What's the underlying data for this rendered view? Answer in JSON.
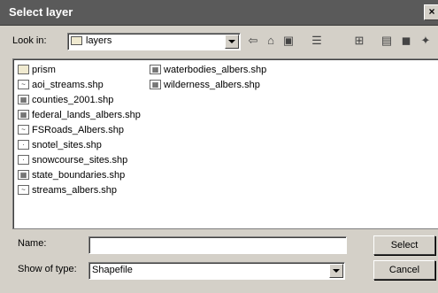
{
  "window": {
    "title": "Select layer",
    "close_glyph": "×"
  },
  "lookin": {
    "label": "Look in:",
    "value": "layers"
  },
  "toolbar": [
    {
      "name": "back-icon",
      "glyph": "⇦"
    },
    {
      "name": "home-icon",
      "glyph": "⌂"
    },
    {
      "name": "connect-folder-icon",
      "glyph": "▣"
    },
    {
      "name": "view-list-icon",
      "glyph": "☰"
    },
    {
      "name": "new-folder-icon",
      "glyph": "⊞"
    },
    {
      "name": "catalog-icon",
      "glyph": "▤"
    },
    {
      "name": "database-icon",
      "glyph": "◼"
    },
    {
      "name": "tools-icon",
      "glyph": "✦"
    }
  ],
  "files_col1": [
    {
      "label": "prism",
      "icon": "folder-icon"
    },
    {
      "label": "aoi_streams.shp",
      "icon": "line-shapefile-icon"
    },
    {
      "label": "counties_2001.shp",
      "icon": "polygon-shapefile-icon"
    },
    {
      "label": "federal_lands_albers.shp",
      "icon": "polygon-shapefile-icon"
    },
    {
      "label": "FSRoads_Albers.shp",
      "icon": "line-shapefile-icon"
    },
    {
      "label": "snotel_sites.shp",
      "icon": "point-shapefile-icon"
    },
    {
      "label": "snowcourse_sites.shp",
      "icon": "point-shapefile-icon"
    },
    {
      "label": "state_boundaries.shp",
      "icon": "polygon-shapefile-icon"
    },
    {
      "label": "streams_albers.shp",
      "icon": "line-shapefile-icon"
    }
  ],
  "files_col2": [
    {
      "label": "waterbodies_albers.shp",
      "icon": "polygon-shapefile-icon"
    },
    {
      "label": "wilderness_albers.shp",
      "icon": "polygon-shapefile-icon"
    }
  ],
  "name": {
    "label": "Name:",
    "value": ""
  },
  "type": {
    "label": "Show of type:",
    "value": "Shapefile"
  },
  "buttons": {
    "select": "Select",
    "cancel": "Cancel"
  }
}
